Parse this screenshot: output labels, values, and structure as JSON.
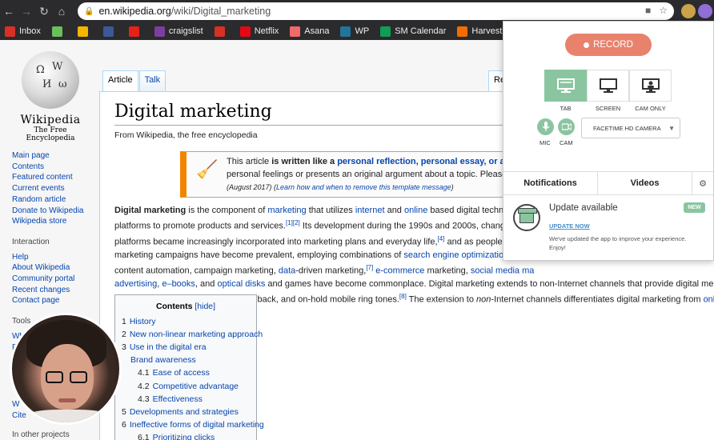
{
  "browser": {
    "url_host": "en.wikipedia.org",
    "url_path": "/wiki/Digital_marketing",
    "bookmarks": [
      {
        "label": "Inbox",
        "icon": "gmail-icon",
        "color": "#d93025"
      },
      {
        "label": "",
        "icon": "drive-pinwheel-icon",
        "color": "#6bbf59"
      },
      {
        "label": "",
        "icon": "google-drive-icon",
        "color": "#f4b400"
      },
      {
        "label": "",
        "icon": "facebook-icon",
        "color": "#3b5998"
      },
      {
        "label": "",
        "icon": "youtube-icon",
        "color": "#e62117"
      },
      {
        "label": "craigslist",
        "icon": "peace-icon",
        "color": "#7b3fa0"
      },
      {
        "label": "",
        "icon": "v-icon",
        "color": "#d93025"
      },
      {
        "label": "Netflix",
        "icon": "netflix-icon",
        "color": "#e50914"
      },
      {
        "label": "Asana",
        "icon": "asana-icon",
        "color": "#f06a6a"
      },
      {
        "label": "WP",
        "icon": "wordpress-icon",
        "color": "#21759b"
      },
      {
        "label": "SM Calendar",
        "icon": "sheets-icon",
        "color": "#0f9d58"
      },
      {
        "label": "Harvest",
        "icon": "harvest-icon",
        "color": "#f36c00"
      },
      {
        "label": "Buffer",
        "icon": "buffer-icon",
        "color": "#333333"
      }
    ]
  },
  "wiki": {
    "logo_wordmark": "Wikipedia",
    "logo_tagline": "The Free Encyclopedia",
    "tab_article": "Article",
    "tab_talk": "Talk",
    "tab_read": "Re",
    "title": "Digital marketing",
    "from": "From Wikipedia, the free encyclopedia",
    "nav_main": [
      "Main page",
      "Contents",
      "Featured content",
      "Current events",
      "Random article",
      "Donate to Wikipedia",
      "Wikipedia store"
    ],
    "interaction_head": "Interaction",
    "nav_interaction": [
      "Help",
      "About Wikipedia",
      "Community portal",
      "Recent changes",
      "Contact page"
    ],
    "tools_head": "Tools",
    "tools_partial": [
      "Wh",
      "R"
    ],
    "tools_lower": [
      "W",
      "Cite"
    ],
    "other_projects": "In other projects",
    "ambox_line1_pre": "This article ",
    "ambox_line1_bold": "is written like a",
    "ambox_line1_link": "personal reflection, personal essay, or argum",
    "ambox_line2": "personal feelings or presents an original argument about a topic. Please ",
    "ambox_line2_link": "help",
    "ambox_line3_pre": "(August 2017) (",
    "ambox_line3_link": "Learn how and when to remove this template message",
    "ambox_line3_post": ")",
    "lead_lines": [
      [
        "b:Digital marketing",
        " is the component of ",
        "a:marketing",
        " that utilizes ",
        "a:internet",
        " and ",
        "a:online",
        " based digital technologies"
      ],
      [
        "platforms to promote products and services.",
        "a:[1][2]",
        " Its development during the 1990s and 2000s, changed the"
      ],
      [
        "platforms became increasingly incorporated into marketing plans and everyday life,",
        "a:[4]",
        " and as people increas"
      ],
      [
        "marketing campaigns have become prevalent, employing combinations of ",
        "a:search engine optimization",
        " (SEO"
      ],
      [
        "content automation, campaign marketing, ",
        "a:data",
        "-driven marketing,",
        "a:[7]",
        " ",
        "a:e-commerce",
        " marketing, ",
        "a:social media ma"
      ],
      [
        "a:advertising",
        ", ",
        "a:e–books",
        ", and ",
        "a:optical disks",
        " and games have become commonplace. Digital marketing extends to non-Internet channels that provide digital media, such as"
      ],
      [
        "mobile phones (",
        "a:SMS",
        " and ",
        "a:MMS",
        "), callback, and on-hold mobile ring tones.",
        "a:[8]",
        " The extension to ",
        "i:non",
        "-Internet channels differentiates digital marketing from ",
        "a:online marketi"
      ]
    ],
    "toc": {
      "title": "Contents",
      "hide": "[hide]",
      "items": [
        {
          "num": "1",
          "text": "History",
          "level": 1
        },
        {
          "num": "2",
          "text": "New non-linear marketing approach",
          "level": 1
        },
        {
          "num": "3",
          "text": "Use in the digital era",
          "level": 1
        },
        {
          "num": "",
          "text": "Brand awareness",
          "level": 1
        },
        {
          "num": "4.1",
          "text": "Ease of access",
          "level": 2
        },
        {
          "num": "4.2",
          "text": "Competitive advantage",
          "level": 2
        },
        {
          "num": "4.3",
          "text": "Effectiveness",
          "level": 2
        },
        {
          "num": "5",
          "text": "Developments and strategies",
          "level": 1
        },
        {
          "num": "6",
          "text": "Ineffective forms of digital marketing",
          "level": 1
        },
        {
          "num": "6.1",
          "text": "Prioritizing clicks",
          "level": 2
        }
      ]
    }
  },
  "recorder": {
    "record_label": "RECORD",
    "modes": [
      "TAB",
      "SCREEN",
      "CAM ONLY"
    ],
    "active_mode": "TAB",
    "mic_label": "MIC",
    "cam_label": "CAM",
    "camera_source": "FACETIME HD CAMERA",
    "tabs": [
      "Notifications",
      "Videos"
    ],
    "notification": {
      "title": "Update available",
      "badge": "NEW",
      "link": "UPDATE NOW",
      "body": "We've updated the app to improve your experience. Enjoy!"
    },
    "accent": "#8bc5a0",
    "record_color": "#e8826c"
  }
}
